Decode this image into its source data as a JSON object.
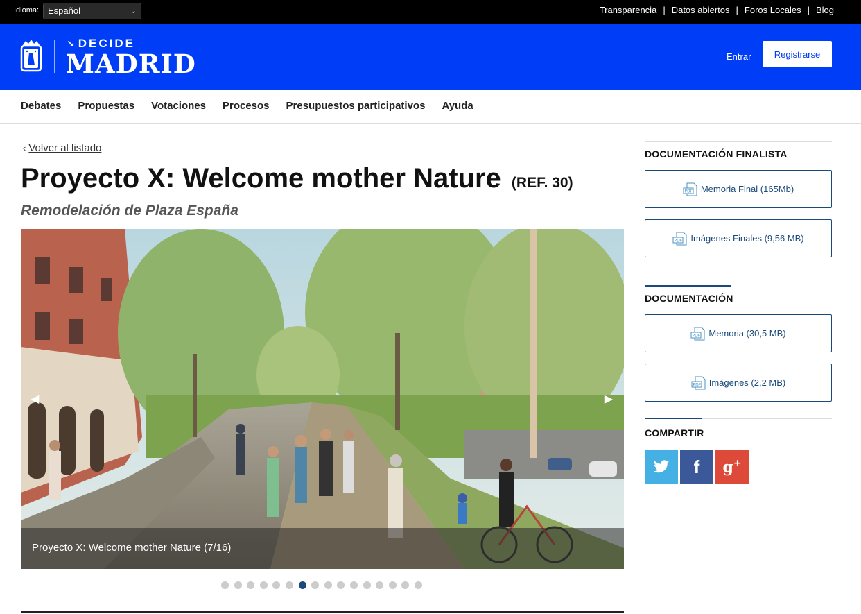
{
  "topbar": {
    "lang_label": "Idioma:",
    "lang_value": "Español",
    "links": [
      "Transparencia",
      "Datos abiertos",
      "Foros Locales",
      "Blog"
    ],
    "separator": "|"
  },
  "header": {
    "logo_top": "DECIDE",
    "logo_bottom": "MADRID",
    "login": "Entrar",
    "register": "Registrarse",
    "brand_color": "#003df6"
  },
  "nav": {
    "items": [
      "Debates",
      "Propuestas",
      "Votaciones",
      "Procesos",
      "Presupuestos participativos",
      "Ayuda"
    ]
  },
  "main": {
    "back": "Volver al listado",
    "title": "Proyecto X: Welcome mother Nature",
    "ref": "(REF. 30)",
    "subtitle": "Remodelación de Plaza España",
    "gallery": {
      "caption": "Proyecto X: Welcome mother Nature (7/16)",
      "total": 16,
      "current": 7,
      "prev": "◀",
      "next": "▶"
    }
  },
  "sidebar": {
    "finalist_heading": "DOCUMENTACIÓN FINALISTA",
    "finalist_docs": [
      "Memoria Final (165Mb)",
      "Imágenes Finales (9,56 MB)"
    ],
    "doc_heading": "DOCUMENTACIÓN",
    "docs": [
      "Memoria (30,5 MB)",
      "Imágenes (2,2 MB)"
    ],
    "share_heading": "COMPARTIR",
    "share_icons": [
      "twitter-icon",
      "facebook-icon",
      "google-plus-icon"
    ],
    "accent_color": "#1a4a7a"
  }
}
